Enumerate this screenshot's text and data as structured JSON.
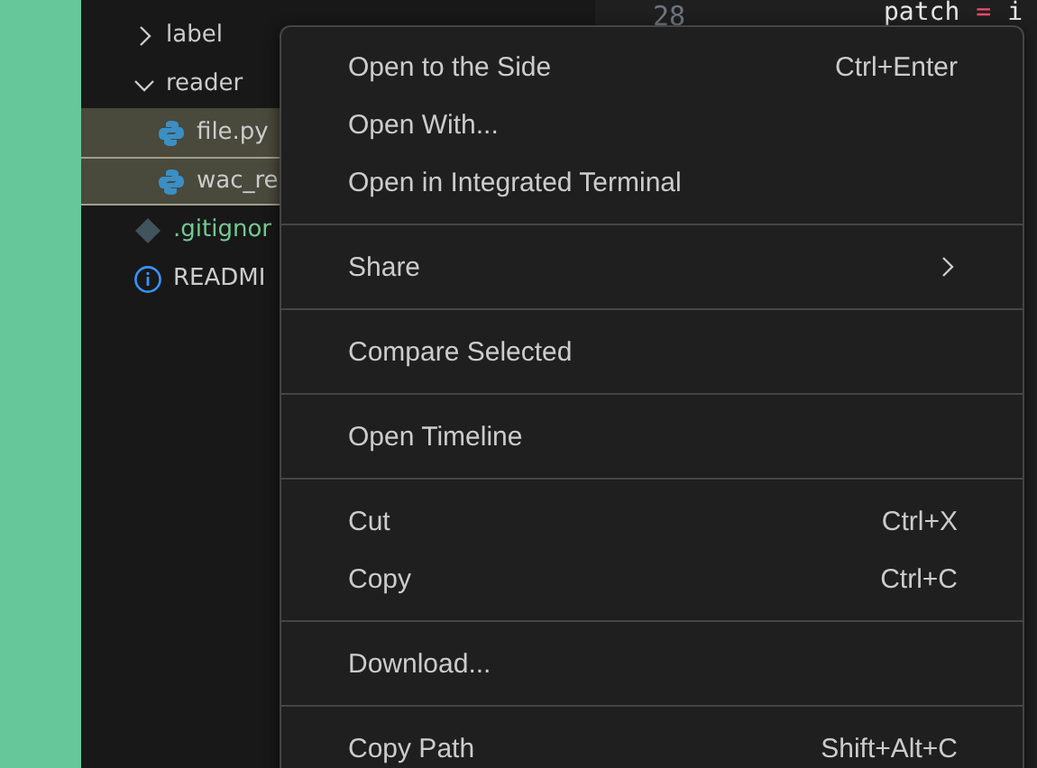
{
  "explorer": {
    "items": [
      {
        "name": "label",
        "kind": "folder",
        "expanded": false
      },
      {
        "name": "reader",
        "kind": "folder",
        "expanded": true,
        "children": [
          {
            "name": "file.py",
            "kind": "python",
            "selected": true,
            "focused": false
          },
          {
            "name": "wac_re",
            "kind": "python",
            "selected": true,
            "focused": true
          }
        ]
      },
      {
        "name": ".gitignor",
        "kind": "git",
        "selected": false
      },
      {
        "name": "READMI",
        "kind": "info",
        "selected": false
      }
    ]
  },
  "editor": {
    "line_number": "28",
    "tokens": [
      {
        "text": "patch",
        "kind": "variable"
      },
      {
        "text": "=",
        "kind": "operator"
      },
      {
        "text": "i",
        "kind": "variable"
      }
    ]
  },
  "context_menu": {
    "groups": [
      [
        {
          "label": "Open to the Side",
          "shortcut": "Ctrl+Enter"
        },
        {
          "label": "Open With..."
        },
        {
          "label": "Open in Integrated Terminal"
        }
      ],
      [
        {
          "label": "Share",
          "submenu": true
        }
      ],
      [
        {
          "label": "Compare Selected"
        }
      ],
      [
        {
          "label": "Open Timeline"
        }
      ],
      [
        {
          "label": "Cut",
          "shortcut": "Ctrl+X"
        },
        {
          "label": "Copy",
          "shortcut": "Ctrl+C"
        }
      ],
      [
        {
          "label": "Download..."
        }
      ],
      [
        {
          "label": "Copy Path",
          "shortcut": "Shift+Alt+C"
        }
      ]
    ]
  }
}
